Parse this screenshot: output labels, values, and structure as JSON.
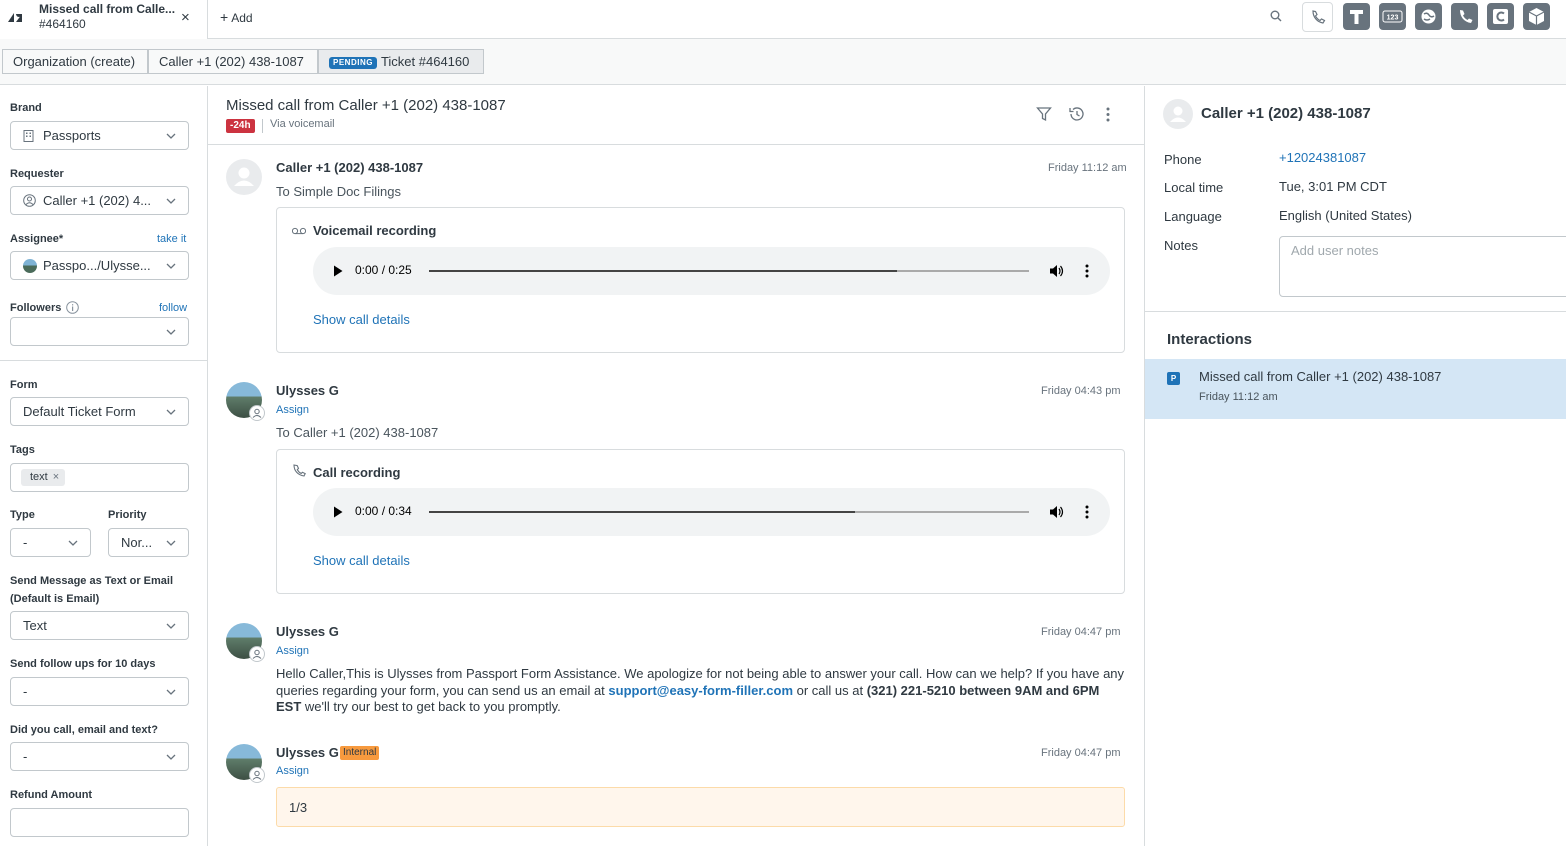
{
  "tab": {
    "title": "Missed call from Calle...",
    "number": "#464160",
    "close": "×"
  },
  "top": {
    "add_label": "Add"
  },
  "breadcrumb": {
    "org": "Organization (create)",
    "caller": "Caller +1 (202) 438-1087",
    "status": "PENDING",
    "ticket": "Ticket #464160"
  },
  "form": {
    "brand_label": "Brand",
    "brand_value": "Passports",
    "requester_label": "Requester",
    "requester_value": "Caller +1 (202) 4...",
    "assignee_label": "Assignee*",
    "take_it": "take it",
    "assignee_value": "Passpo.../Ulysse...",
    "followers_label": "Followers",
    "follow": "follow",
    "form_label": "Form",
    "form_value": "Default Ticket Form",
    "tags_label": "Tags",
    "tag": "text",
    "type_label": "Type",
    "type_value": "-",
    "priority_label": "Priority",
    "priority_value": "Nor...",
    "send_msg_label_1": "Send Message as Text or Email",
    "send_msg_label_2": "(Default is Email)",
    "send_msg_value": "Text",
    "followups_label": "Send follow ups for 10 days",
    "followups_value": "-",
    "did_you_label": "Did you call, email and text?",
    "did_you_value": "-",
    "refund_label": "Refund Amount"
  },
  "ticket": {
    "title": "Missed call from Caller +1 (202) 438-1087",
    "sla": "-24h",
    "via": "Via voicemail"
  },
  "messages": [
    {
      "sender": "Caller +1 (202) 438-1087",
      "time": "Friday 11:12 am",
      "to": "To Simple Doc Filings",
      "card_title": "Voicemail recording",
      "player_time": "0:00 / 0:25",
      "progress": 0.78,
      "details": "Show call details"
    },
    {
      "sender": "Ulysses G",
      "assign": "Assign",
      "time": "Friday 04:43 pm",
      "to": "To Caller +1 (202) 438-1087",
      "card_title": "Call recording",
      "player_time": "0:00 / 0:34",
      "progress": 0.71,
      "details": "Show call details"
    },
    {
      "sender": "Ulysses G",
      "assign": "Assign",
      "time": "Friday 04:47 pm",
      "body_1": "Hello Caller,This is Ulysses from Passport Form Assistance. We apologize for not being able to answer your call. How can we help? If you have any queries regarding your form, you can send us an email at ",
      "email": "support@easy-form-filler.com",
      "body_2": " or call us at ",
      "bold_text": "(321) 221-5210 between 9AM and 6PM EST",
      "body_3": " we'll try our best to get back to you promptly."
    },
    {
      "sender": "Ulysses G",
      "internal": "Internal",
      "assign": "Assign",
      "time": "Friday 04:47 pm",
      "note": "1/3"
    }
  ],
  "user": {
    "name": "Caller +1 (202) 438-1087",
    "phone_label": "Phone",
    "phone": "+12024381087",
    "time_label": "Local time",
    "time": "Tue, 3:01 PM CDT",
    "language_label": "Language",
    "language": "English (United States)",
    "notes_label": "Notes",
    "notes_placeholder": "Add user notes"
  },
  "interactions": {
    "title": "Interactions",
    "item_badge": "P",
    "item_title": "Missed call from Caller +1 (202) 438-1087",
    "item_time": "Friday 11:12 am"
  },
  "colors": {
    "accent": "#1f73b7",
    "sla": "#cc3340",
    "internal": "#f79a3e",
    "note_bg": "#fff6ec",
    "selected": "#d4e6f5"
  }
}
